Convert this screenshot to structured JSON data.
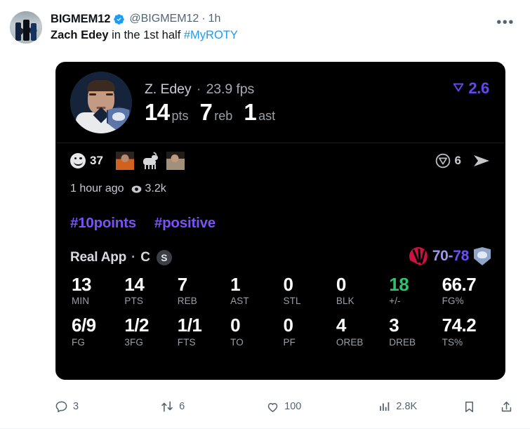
{
  "tweet": {
    "display_name": "BIGMEM12",
    "verified_icon": "verified-badge-icon",
    "handle": "@BIGMEM12",
    "separator": "·",
    "age": "1h",
    "text_bold": "Zach Edey",
    "text_rest": " in the 1st half ",
    "text_hashtag": "#MyROTY",
    "more_label": "•••",
    "avatar_icon": "user-avatar-image",
    "link_color": "#1d9bf0"
  },
  "card": {
    "player": {
      "name_line": "Z. Edey",
      "separator": "·",
      "fps": "23.9 fps",
      "photo_icon": "player-headshot-image",
      "team_badge_icon": "grizzlies-badge-icon",
      "stats": [
        {
          "value": "14",
          "label": "pts"
        },
        {
          "value": "7",
          "label": "reb"
        },
        {
          "value": "1",
          "label": "ast"
        }
      ],
      "trend": {
        "glyph": "⟆",
        "value": "2.6",
        "color": "#6248f0"
      }
    },
    "reactions": {
      "smiley_icon": "smiley-face-icon",
      "count": "37",
      "stickers": [
        "reaction-person-orange-image",
        "reaction-goat-image",
        "reaction-person-tan-image"
      ],
      "vote_icon": "downvote-circle-icon",
      "vote_count": "6",
      "send_icon": "send-arrow-icon"
    },
    "meta": {
      "time": "1 hour ago",
      "views_icon": "eye-icon",
      "views": "3.2k"
    },
    "hashtags": [
      "#10points",
      "#positive"
    ],
    "app": {
      "name": "Real App",
      "separator": "·",
      "letter": "C",
      "chip": "S"
    },
    "score": {
      "away_logo_icon": "raptors-logo-icon",
      "away": "70",
      "dash": "-",
      "home": "78",
      "home_logo_icon": "grizzlies-logo-icon"
    },
    "stat_rows": [
      [
        {
          "value": "13",
          "label": "MIN",
          "color": "#ffffff"
        },
        {
          "value": "14",
          "label": "PTS",
          "color": "#ffffff"
        },
        {
          "value": "7",
          "label": "REB",
          "color": "#ffffff"
        },
        {
          "value": "1",
          "label": "AST",
          "color": "#ffffff"
        },
        {
          "value": "0",
          "label": "STL",
          "color": "#ffffff"
        },
        {
          "value": "0",
          "label": "BLK",
          "color": "#ffffff"
        },
        {
          "value": "18",
          "label": "+/-",
          "color": "#2fc06b"
        },
        {
          "value": "66.7",
          "label": "FG%",
          "color": "#ffffff"
        }
      ],
      [
        {
          "value": "6/9",
          "label": "FG",
          "color": "#ffffff"
        },
        {
          "value": "1/2",
          "label": "3FG",
          "color": "#ffffff"
        },
        {
          "value": "1/1",
          "label": "FTS",
          "color": "#ffffff"
        },
        {
          "value": "0",
          "label": "TO",
          "color": "#ffffff"
        },
        {
          "value": "0",
          "label": "PF",
          "color": "#ffffff"
        },
        {
          "value": "4",
          "label": "OREB",
          "color": "#ffffff"
        },
        {
          "value": "3",
          "label": "DREB",
          "color": "#ffffff"
        },
        {
          "value": "74.2",
          "label": "TS%",
          "color": "#ffffff"
        }
      ]
    ]
  },
  "actions": {
    "reply": {
      "icon": "reply-icon",
      "count": "3"
    },
    "retweet": {
      "icon": "retweet-icon",
      "count": "6"
    },
    "like": {
      "icon": "heart-icon",
      "count": "100"
    },
    "views": {
      "icon": "bar-chart-icon",
      "count": "2.8K"
    },
    "bookmark": {
      "icon": "bookmark-icon"
    },
    "share": {
      "icon": "share-icon"
    }
  }
}
